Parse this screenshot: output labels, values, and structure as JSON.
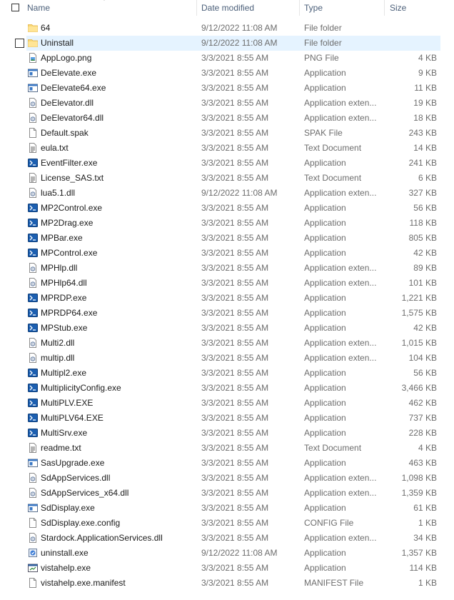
{
  "header": {
    "name": "Name",
    "date_modified": "Date modified",
    "type": "Type",
    "size": "Size"
  },
  "colors": {
    "folder": "#f8d775",
    "selection": "#e5f3ff",
    "exe_blue": "#1c5fb0"
  },
  "files": [
    {
      "name": "64",
      "date": "9/12/2022 11:08 AM",
      "type": "File folder",
      "size": "",
      "icon": "folder-icon"
    },
    {
      "name": "Uninstall",
      "date": "9/12/2022 11:08 AM",
      "type": "File folder",
      "size": "",
      "icon": "folder-icon",
      "selected": true
    },
    {
      "name": "AppLogo.png",
      "date": "3/3/2021 8:55 AM",
      "type": "PNG File",
      "size": "4 KB",
      "icon": "image-file-icon"
    },
    {
      "name": "DeElevate.exe",
      "date": "3/3/2021 8:55 AM",
      "type": "Application",
      "size": "9 KB",
      "icon": "window-app-icon"
    },
    {
      "name": "DeElevate64.exe",
      "date": "3/3/2021 8:55 AM",
      "type": "Application",
      "size": "11 KB",
      "icon": "window-app-icon"
    },
    {
      "name": "DeElevator.dll",
      "date": "3/3/2021 8:55 AM",
      "type": "Application exten...",
      "size": "19 KB",
      "icon": "dll-gear-icon"
    },
    {
      "name": "DeElevator64.dll",
      "date": "3/3/2021 8:55 AM",
      "type": "Application exten...",
      "size": "18 KB",
      "icon": "dll-gear-icon"
    },
    {
      "name": "Default.spak",
      "date": "3/3/2021 8:55 AM",
      "type": "SPAK File",
      "size": "243 KB",
      "icon": "blank-file-icon"
    },
    {
      "name": "eula.txt",
      "date": "3/3/2021 8:55 AM",
      "type": "Text Document",
      "size": "14 KB",
      "icon": "text-file-icon"
    },
    {
      "name": "EventFilter.exe",
      "date": "3/3/2021 8:55 AM",
      "type": "Application",
      "size": "241 KB",
      "icon": "multiplicity-app-icon"
    },
    {
      "name": "License_SAS.txt",
      "date": "3/3/2021 8:55 AM",
      "type": "Text Document",
      "size": "6 KB",
      "icon": "text-file-icon"
    },
    {
      "name": "lua5.1.dll",
      "date": "9/12/2022 11:08 AM",
      "type": "Application exten...",
      "size": "327 KB",
      "icon": "dll-gear-icon"
    },
    {
      "name": "MP2Control.exe",
      "date": "3/3/2021 8:55 AM",
      "type": "Application",
      "size": "56 KB",
      "icon": "multiplicity-app-icon"
    },
    {
      "name": "MP2Drag.exe",
      "date": "3/3/2021 8:55 AM",
      "type": "Application",
      "size": "118 KB",
      "icon": "multiplicity-app-icon"
    },
    {
      "name": "MPBar.exe",
      "date": "3/3/2021 8:55 AM",
      "type": "Application",
      "size": "805 KB",
      "icon": "multiplicity-app-icon"
    },
    {
      "name": "MPControl.exe",
      "date": "3/3/2021 8:55 AM",
      "type": "Application",
      "size": "42 KB",
      "icon": "multiplicity-app-icon"
    },
    {
      "name": "MPHlp.dll",
      "date": "3/3/2021 8:55 AM",
      "type": "Application exten...",
      "size": "89 KB",
      "icon": "dll-gear-icon"
    },
    {
      "name": "MPHlp64.dll",
      "date": "3/3/2021 8:55 AM",
      "type": "Application exten...",
      "size": "101 KB",
      "icon": "dll-gear-icon"
    },
    {
      "name": "MPRDP.exe",
      "date": "3/3/2021 8:55 AM",
      "type": "Application",
      "size": "1,221 KB",
      "icon": "multiplicity-app-icon"
    },
    {
      "name": "MPRDP64.exe",
      "date": "3/3/2021 8:55 AM",
      "type": "Application",
      "size": "1,575 KB",
      "icon": "multiplicity-app-icon"
    },
    {
      "name": "MPStub.exe",
      "date": "3/3/2021 8:55 AM",
      "type": "Application",
      "size": "42 KB",
      "icon": "multiplicity-app-icon"
    },
    {
      "name": "Multi2.dll",
      "date": "3/3/2021 8:55 AM",
      "type": "Application exten...",
      "size": "1,015 KB",
      "icon": "dll-gear-icon"
    },
    {
      "name": "multip.dll",
      "date": "3/3/2021 8:55 AM",
      "type": "Application exten...",
      "size": "104 KB",
      "icon": "dll-gear-icon"
    },
    {
      "name": "Multipl2.exe",
      "date": "3/3/2021 8:55 AM",
      "type": "Application",
      "size": "56 KB",
      "icon": "multiplicity-app-icon"
    },
    {
      "name": "MultiplicityConfig.exe",
      "date": "3/3/2021 8:55 AM",
      "type": "Application",
      "size": "3,466 KB",
      "icon": "multiplicity-app-icon"
    },
    {
      "name": "MultiPLV.EXE",
      "date": "3/3/2021 8:55 AM",
      "type": "Application",
      "size": "462 KB",
      "icon": "multiplicity-app-icon"
    },
    {
      "name": "MultiPLV64.EXE",
      "date": "3/3/2021 8:55 AM",
      "type": "Application",
      "size": "737 KB",
      "icon": "multiplicity-app-icon"
    },
    {
      "name": "MultiSrv.exe",
      "date": "3/3/2021 8:55 AM",
      "type": "Application",
      "size": "228 KB",
      "icon": "multiplicity-app-icon"
    },
    {
      "name": "readme.txt",
      "date": "3/3/2021 8:55 AM",
      "type": "Text Document",
      "size": "4 KB",
      "icon": "text-file-icon"
    },
    {
      "name": "SasUpgrade.exe",
      "date": "3/3/2021 8:55 AM",
      "type": "Application",
      "size": "463 KB",
      "icon": "window-app-icon"
    },
    {
      "name": "SdAppServices.dll",
      "date": "3/3/2021 8:55 AM",
      "type": "Application exten...",
      "size": "1,098 KB",
      "icon": "dll-gear-icon"
    },
    {
      "name": "SdAppServices_x64.dll",
      "date": "3/3/2021 8:55 AM",
      "type": "Application exten...",
      "size": "1,359 KB",
      "icon": "dll-gear-icon"
    },
    {
      "name": "SdDisplay.exe",
      "date": "3/3/2021 8:55 AM",
      "type": "Application",
      "size": "61 KB",
      "icon": "window-app-icon"
    },
    {
      "name": "SdDisplay.exe.config",
      "date": "3/3/2021 8:55 AM",
      "type": "CONFIG File",
      "size": "1 KB",
      "icon": "blank-file-icon"
    },
    {
      "name": "Stardock.ApplicationServices.dll",
      "date": "3/3/2021 8:55 AM",
      "type": "Application exten...",
      "size": "34 KB",
      "icon": "dll-gear-icon"
    },
    {
      "name": "uninstall.exe",
      "date": "9/12/2022 11:08 AM",
      "type": "Application",
      "size": "1,357 KB",
      "icon": "installer-icon"
    },
    {
      "name": "vistahelp.exe",
      "date": "3/3/2021 8:55 AM",
      "type": "Application",
      "size": "114 KB",
      "icon": "help-app-icon"
    },
    {
      "name": "vistahelp.exe.manifest",
      "date": "3/3/2021 8:55 AM",
      "type": "MANIFEST File",
      "size": "1 KB",
      "icon": "blank-file-icon"
    }
  ]
}
